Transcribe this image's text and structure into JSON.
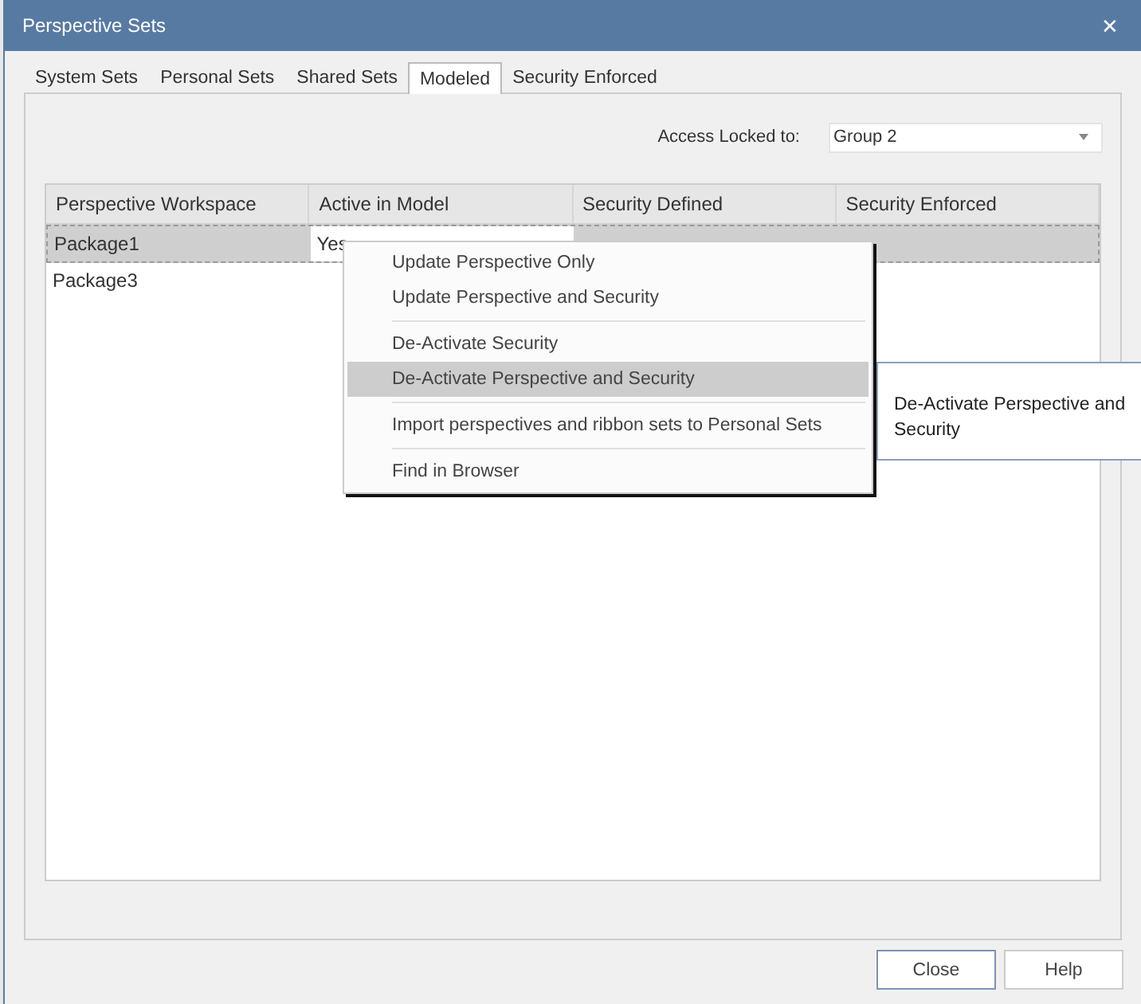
{
  "window": {
    "title": "Perspective Sets",
    "close_glyph": "✕"
  },
  "tabs": [
    {
      "label": "System Sets",
      "selected": false
    },
    {
      "label": "Personal Sets",
      "selected": false
    },
    {
      "label": "Shared Sets",
      "selected": false
    },
    {
      "label": "Modeled",
      "selected": true
    },
    {
      "label": "Security Enforced",
      "selected": false
    }
  ],
  "access": {
    "label": "Access Locked to:",
    "value": "Group 2"
  },
  "table": {
    "columns": [
      "Perspective Workspace",
      "Active in Model",
      "Security Defined",
      "Security Enforced"
    ],
    "rows": [
      {
        "cells": [
          "Package1",
          "Yes"
        ],
        "selected": true
      },
      {
        "cells": [
          "Package3"
        ],
        "selected": false
      }
    ]
  },
  "context_menu": {
    "items": [
      {
        "kind": "item",
        "label": "Update Perspective Only",
        "selected": false
      },
      {
        "kind": "item",
        "label": "Update Perspective and Security",
        "selected": false
      },
      {
        "kind": "separator"
      },
      {
        "kind": "item",
        "label": "De-Activate Security",
        "selected": false
      },
      {
        "kind": "item",
        "label": "De-Activate Perspective and Security",
        "selected": true
      },
      {
        "kind": "separator"
      },
      {
        "kind": "item",
        "label": "Import perspectives and ribbon sets to Personal Sets",
        "selected": false
      },
      {
        "kind": "separator"
      },
      {
        "kind": "item",
        "label": "Find in Browser",
        "selected": false
      }
    ]
  },
  "tooltip": "De-Activate Perspective and Security",
  "buttons": [
    {
      "label": "Close",
      "kind": "default"
    },
    {
      "label": "Help",
      "kind": "normal"
    }
  ]
}
